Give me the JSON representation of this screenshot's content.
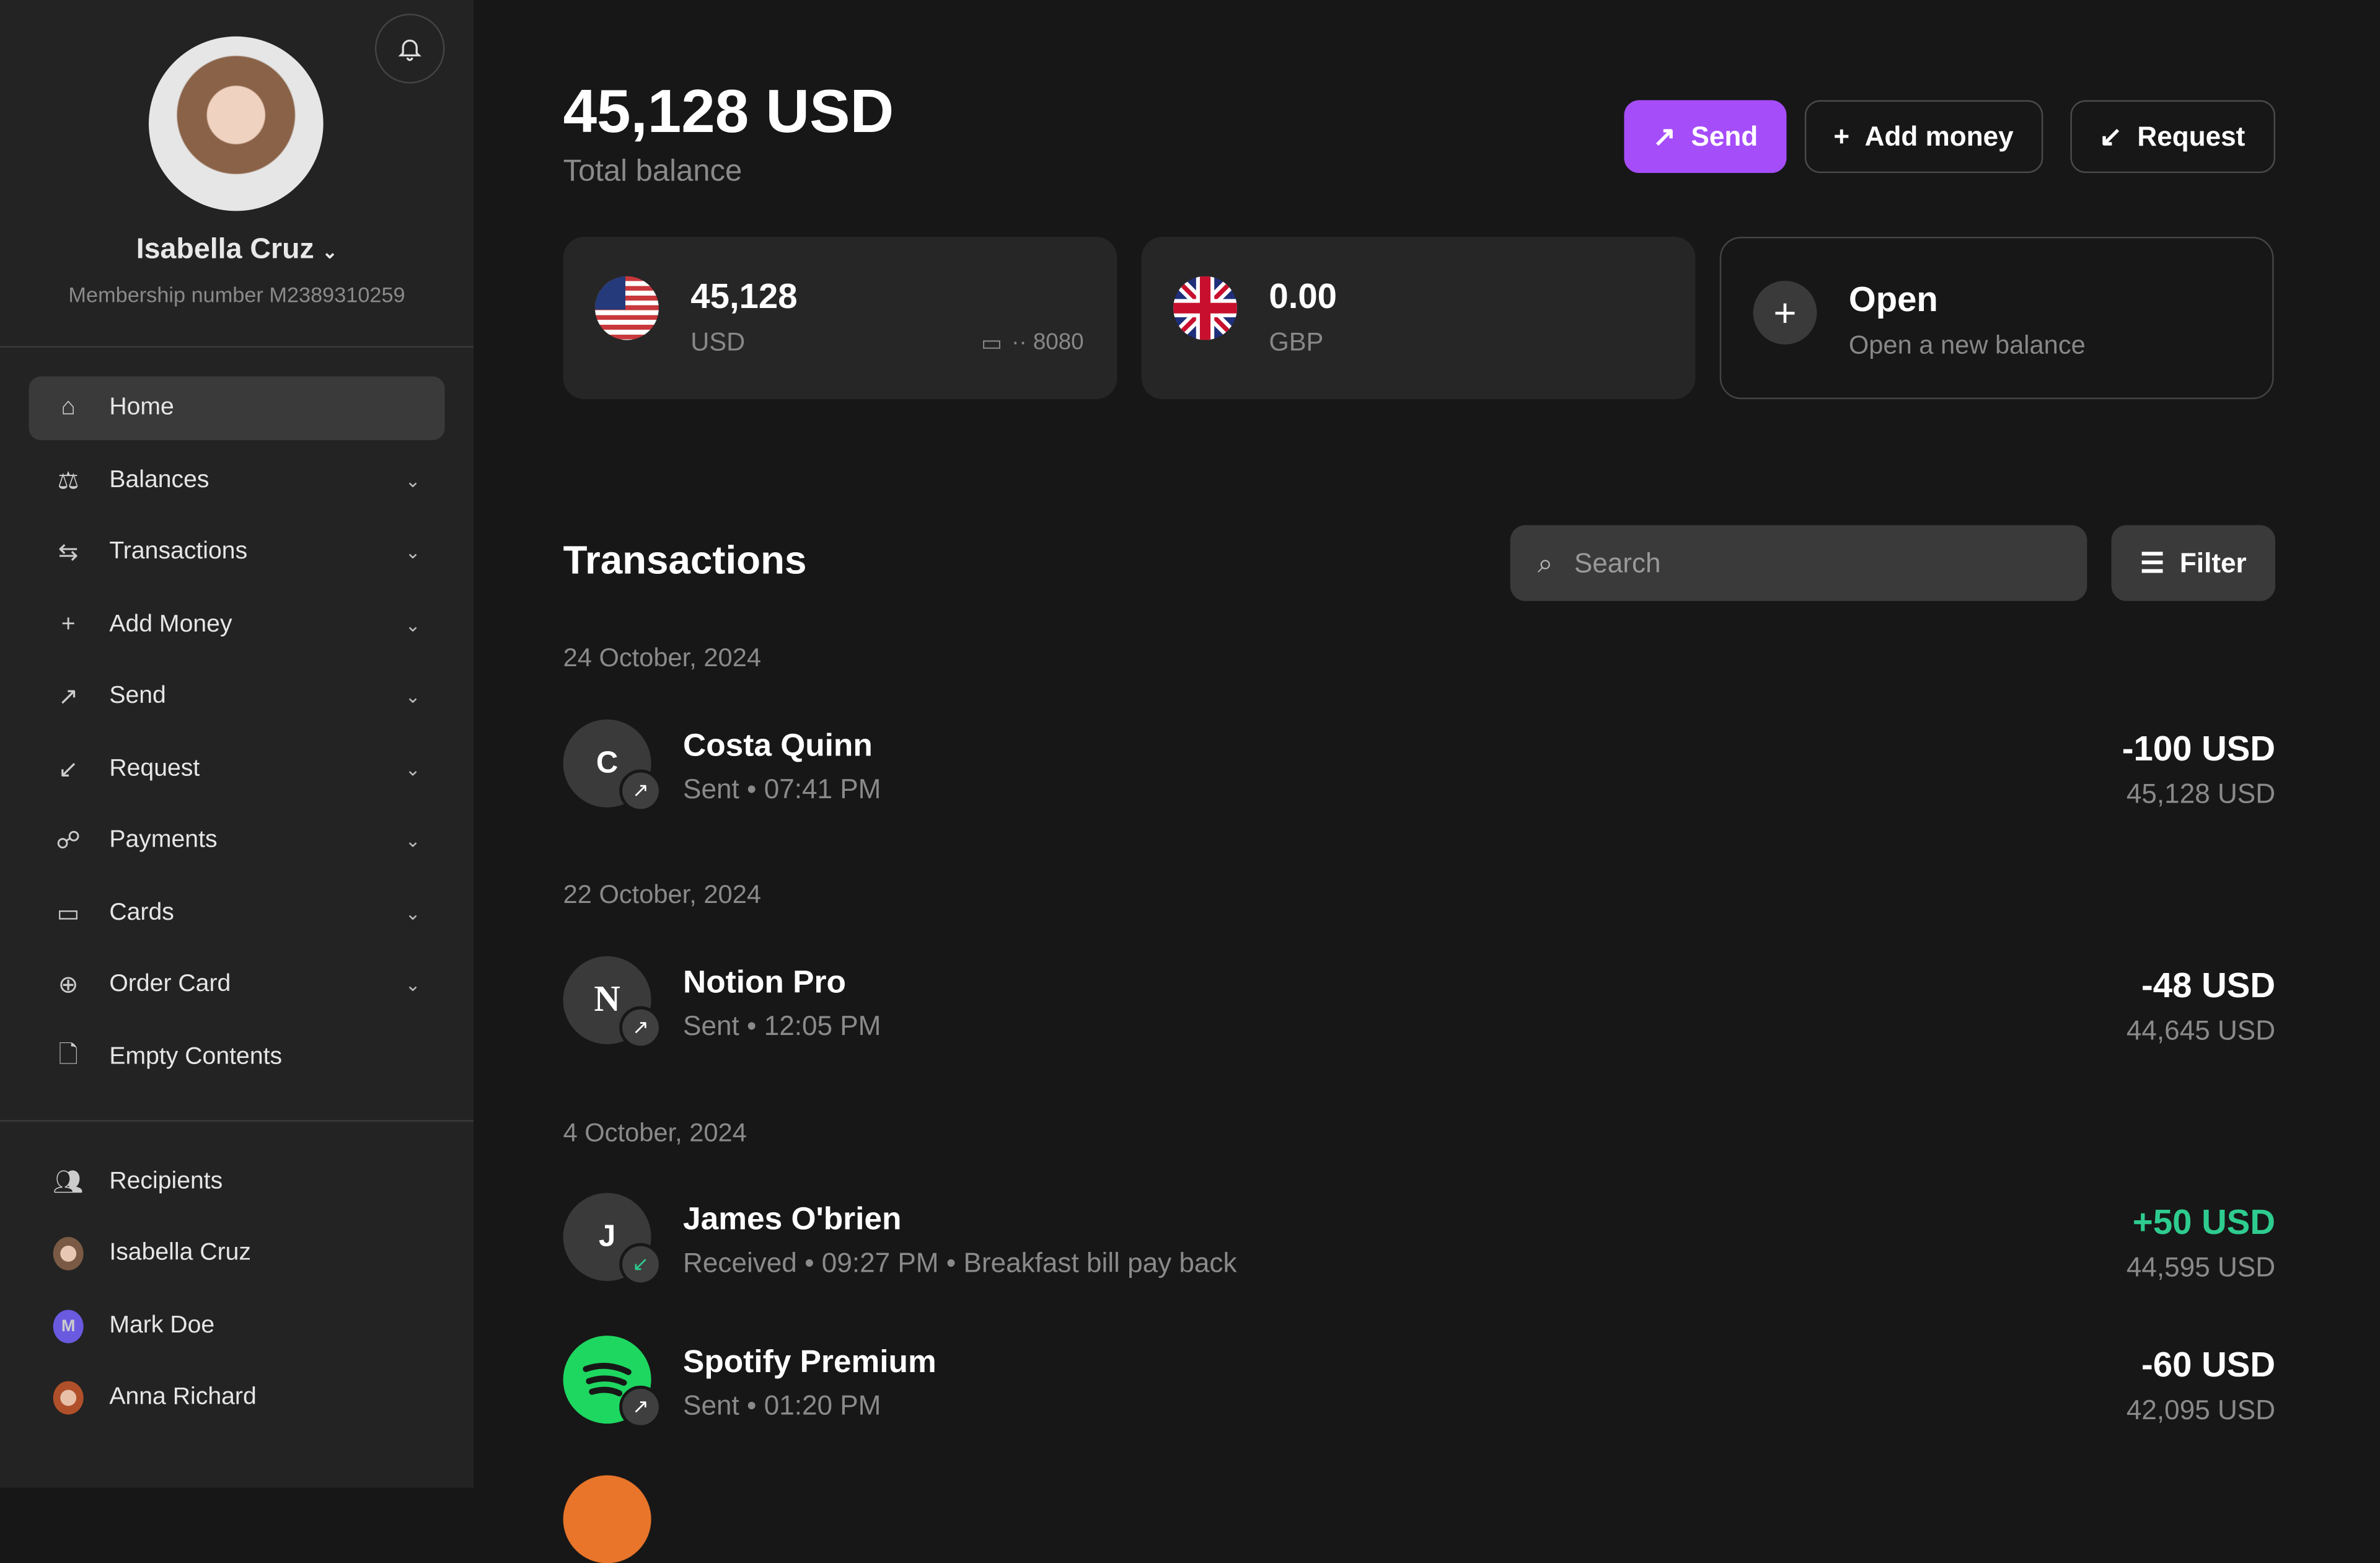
{
  "sidebar": {
    "user_name": "Isabella Cruz",
    "membership": "Membership number M2389310259",
    "nav": [
      {
        "label": "Home",
        "icon": "home-icon"
      },
      {
        "label": "Balances",
        "icon": "scale-icon"
      },
      {
        "label": "Transactions",
        "icon": "arrows-icon"
      },
      {
        "label": "Add Money",
        "icon": "plus-icon"
      },
      {
        "label": "Send",
        "icon": "arrow-up-right-icon"
      },
      {
        "label": "Request",
        "icon": "arrow-down-left-icon"
      },
      {
        "label": "Payments",
        "icon": "hand-coins-icon"
      },
      {
        "label": "Cards",
        "icon": "card-icon"
      },
      {
        "label": "Order Card",
        "icon": "plus-circle-icon"
      },
      {
        "label": "Empty Contents",
        "icon": "file-icon"
      }
    ],
    "recipients_label": "Recipients",
    "recipients": [
      {
        "name": "Isabella Cruz",
        "initial": ""
      },
      {
        "name": "Mark Doe",
        "initial": "M"
      },
      {
        "name": "Anna Richard",
        "initial": ""
      }
    ]
  },
  "header": {
    "total": "45,128 USD",
    "total_label": "Total balance",
    "send": "Send",
    "add_money": "Add money",
    "request": "Request"
  },
  "balances": [
    {
      "amount": "45,128",
      "currency": "USD",
      "card": "·· 8080"
    },
    {
      "amount": "0.00",
      "currency": "GBP"
    }
  ],
  "open_card": {
    "title": "Open",
    "subtitle": "Open a new balance"
  },
  "transactions": {
    "title": "Transactions",
    "search_placeholder": "Search",
    "filter": "Filter",
    "groups": [
      {
        "date": "24 October, 2024",
        "items": [
          {
            "initial": "C",
            "name": "Costa Quinn",
            "type": "Sent",
            "time": "• 07:41 PM",
            "note": "",
            "amount": "-100 USD",
            "balance": "45,128 USD"
          }
        ]
      },
      {
        "date": "22 October, 2024",
        "items": [
          {
            "initial": "N",
            "name": "Notion Pro",
            "type": "Sent",
            "time": "• 12:05 PM",
            "note": "",
            "amount": "-48 USD",
            "balance": "44,645 USD"
          }
        ]
      },
      {
        "date": "4 October, 2024",
        "items": [
          {
            "initial": "J",
            "name": "James O'brien",
            "type": "Received",
            "time": "• 09:27 PM",
            "note": "• Breakfast bill pay back",
            "amount": "+50 USD",
            "balance": "44,595 USD"
          },
          {
            "initial": "",
            "name": "Spotify Premium",
            "type": "Sent",
            "time": "• 01:20 PM",
            "note": "",
            "amount": "-60 USD",
            "balance": "42,095 USD"
          }
        ]
      }
    ]
  },
  "colors": {
    "accent": "#a64dfa",
    "positive": "#2ecc8f",
    "bg": "#171717",
    "sidebar": "#232323"
  }
}
